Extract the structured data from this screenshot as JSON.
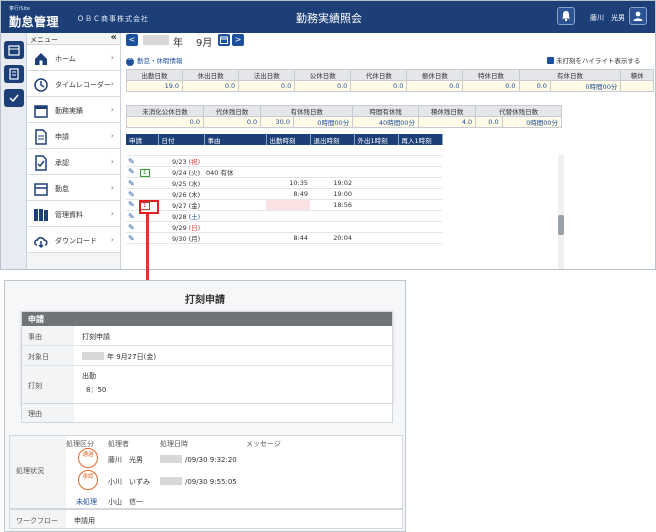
{
  "header": {
    "logo_small": "奉行iSite",
    "logo": "勤怠管理",
    "company": "ＯＢＣ商事株式会社",
    "title": "勤務実績照会",
    "user": "藤川　光男"
  },
  "menu": {
    "title": "メニュー",
    "collapse": "«",
    "items": [
      {
        "label": "ホーム"
      },
      {
        "label": "タイムレコーダー"
      },
      {
        "label": "勤務実績"
      },
      {
        "label": "申請"
      },
      {
        "label": "承認"
      },
      {
        "label": "勤怠"
      },
      {
        "label": "管理資料"
      },
      {
        "label": "ダウンロード"
      }
    ],
    "arrow": "›"
  },
  "period": {
    "prev": "<",
    "year_suffix": "年",
    "month": "9月",
    "next": ">"
  },
  "section_label": "勤怠・休暇情報",
  "highlight_option": "未打刻をハイライト表示する",
  "summary1": {
    "headers": [
      "出勤日数",
      "休出日数",
      "法出日数",
      "公休日数",
      "代休日数",
      "振休日数",
      "特休日数",
      "有休日数",
      "",
      "積休"
    ],
    "values": [
      "19.0",
      "0.0",
      "0.0",
      "0.0",
      "0.0",
      "0.0",
      "0.0",
      "0.0",
      "0時間00分",
      ""
    ]
  },
  "summary2": {
    "headers": [
      "未消化公休日数",
      "代休残日数",
      "有休残日数",
      "",
      "時間有休残",
      "積休残日数",
      "代替休残日数",
      ""
    ],
    "values": [
      "0.0",
      "0.0",
      "30.0",
      "0時間00分",
      "40時間00分",
      "4.0",
      "0.0",
      "0時間00分"
    ]
  },
  "days_table": {
    "headers": [
      "申請",
      "日付",
      "事由",
      "出勤時刻",
      "退出時刻",
      "外出1時刻",
      "再入1時刻"
    ],
    "rows": [
      {
        "badge": "",
        "date": "9/23",
        "dow": "(祝)",
        "dow_type": "sun",
        "reason": "",
        "in": "",
        "out": ""
      },
      {
        "badge": "1",
        "badge_type": "green",
        "date": "9/24",
        "dow": "(火)",
        "dow_type": "",
        "reason": "040 有休",
        "in": "",
        "out": ""
      },
      {
        "badge": "",
        "date": "9/25",
        "dow": "(水)",
        "dow_type": "",
        "reason": "",
        "in": "10:35",
        "out": "19:02"
      },
      {
        "badge": "",
        "date": "9/26",
        "dow": "(木)",
        "dow_type": "",
        "reason": "",
        "in": "8:49",
        "out": "19:00"
      },
      {
        "badge": "1",
        "badge_type": "red",
        "date": "9/27",
        "dow": "(金)",
        "dow_type": "",
        "reason": "",
        "in": "",
        "out": "18:56",
        "in_pink": true
      },
      {
        "badge": "",
        "date": "9/28",
        "dow": "(土)",
        "dow_type": "sat",
        "reason": "",
        "in": "",
        "out": ""
      },
      {
        "badge": "",
        "date": "9/29",
        "dow": "(日)",
        "dow_type": "sun",
        "reason": "",
        "in": "",
        "out": ""
      },
      {
        "badge": "",
        "date": "9/30",
        "dow": "(月)",
        "dow_type": "",
        "reason": "",
        "in": "8:44",
        "out": "20:04"
      }
    ]
  },
  "dialog": {
    "title": "打刻申請",
    "panel_title": "申請",
    "reason_key": "事由",
    "reason_value": "打刻申請",
    "date_key": "対象日",
    "date_suffix": "年  9月27日(金)",
    "punch_key": "打刻",
    "punch_type": "出勤",
    "punch_time": "8：50",
    "note_key": "理由",
    "status_key": "処理状況",
    "status_headers": [
      "処理区分",
      "処理者",
      "処理日時",
      "メッセージ"
    ],
    "status_rows": [
      {
        "stamp_top": "通過",
        "stamp_bottom": "",
        "name": "藤川　光男",
        "datetime": "/09/30  9:32:20"
      },
      {
        "stamp_top": "承認",
        "stamp_bottom": "",
        "name": "小川　いずみ",
        "datetime": "/09/30  9:55:05"
      }
    ],
    "unprocessed_label": "未処理",
    "unprocessed_name": "小山　信一",
    "workflow_key": "ワークフロー",
    "workflow_value": "申請用"
  },
  "colors": {
    "brand": "#1c3f78",
    "accent": "#e0342f"
  }
}
